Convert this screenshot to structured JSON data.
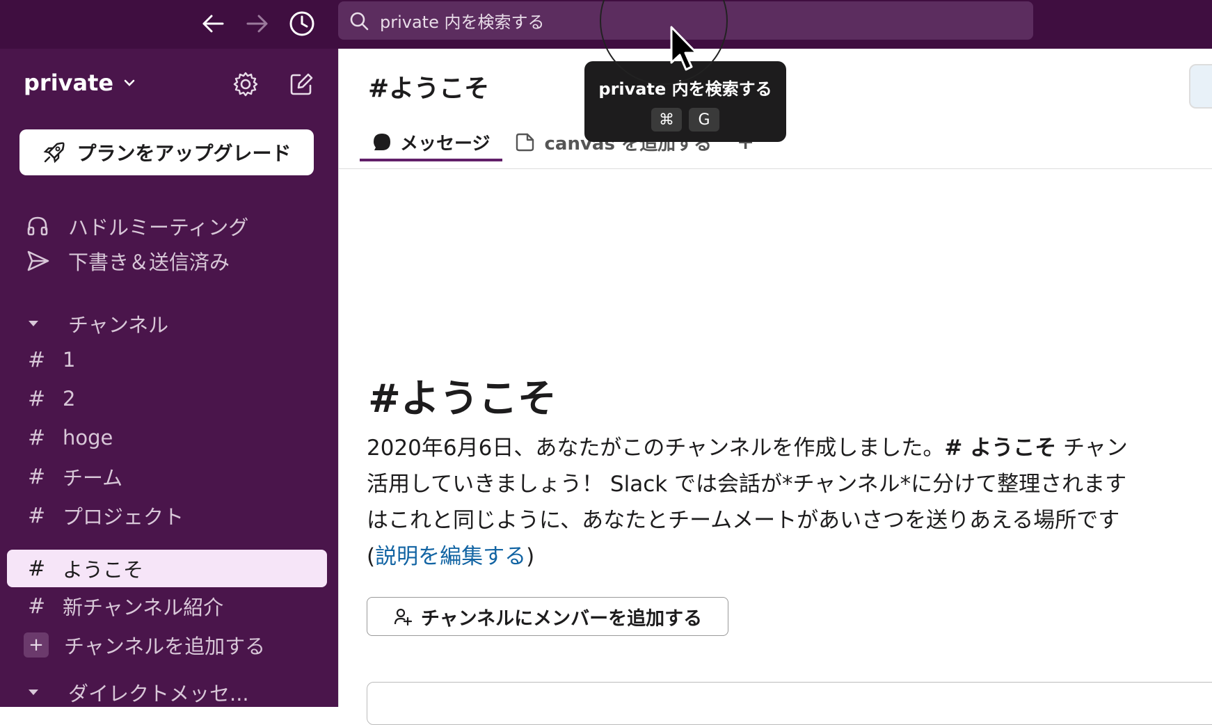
{
  "colors": {
    "topbar": "#3f0e40",
    "sidebar": "#4a154b",
    "accent": "#611f69",
    "link": "#1264a3",
    "active_row": "#f6e5f8"
  },
  "topbar": {
    "search_placeholder": "private 内を検索する"
  },
  "sidebar": {
    "workspace_name": "private",
    "upgrade_label": "プランをアップグレード",
    "nav_items": [
      {
        "label": "ハドルミーティング",
        "icon": "headphones-icon"
      },
      {
        "label": "下書き＆送信済み",
        "icon": "send-icon"
      }
    ],
    "channels_header": "チャンネル",
    "channels": [
      {
        "name": "1",
        "active": false
      },
      {
        "name": "2",
        "active": false
      },
      {
        "name": "hoge",
        "active": false
      },
      {
        "name": "チーム",
        "active": false
      },
      {
        "name": "プロジェクト",
        "active": false
      },
      {
        "name": "ようこそ",
        "active": true
      },
      {
        "name": "新チャンネル紹介",
        "active": false
      }
    ],
    "add_channel_label": "チャンネルを追加する",
    "dm_header": "ダイレクトメッセ..."
  },
  "main": {
    "channel_title": "#ようこそ",
    "tabs": [
      {
        "label": "メッセージ",
        "selected": true
      },
      {
        "label": "canvas を追加する",
        "selected": false
      }
    ],
    "intro_title": "#ようこそ",
    "intro_line1_a": "2020年6月6日、あなたがこのチャンネルを作成しました。",
    "intro_line1_bold": "# ようこそ",
    "intro_line1_b": " チャン",
    "intro_line2": "活用していきましょう！ Slack では会話が*チャンネル*に分けて整理されます",
    "intro_line3": "はこれと同じように、あなたとチームメートがあいさつを送りあえる場所です",
    "edit_desc_open": "(",
    "edit_desc_link": "説明を編集する",
    "edit_desc_close": ")",
    "add_members_label": "チャンネルにメンバーを追加する"
  },
  "tooltip": {
    "text": "private 内を検索する",
    "keys": [
      "⌘",
      "G"
    ]
  }
}
